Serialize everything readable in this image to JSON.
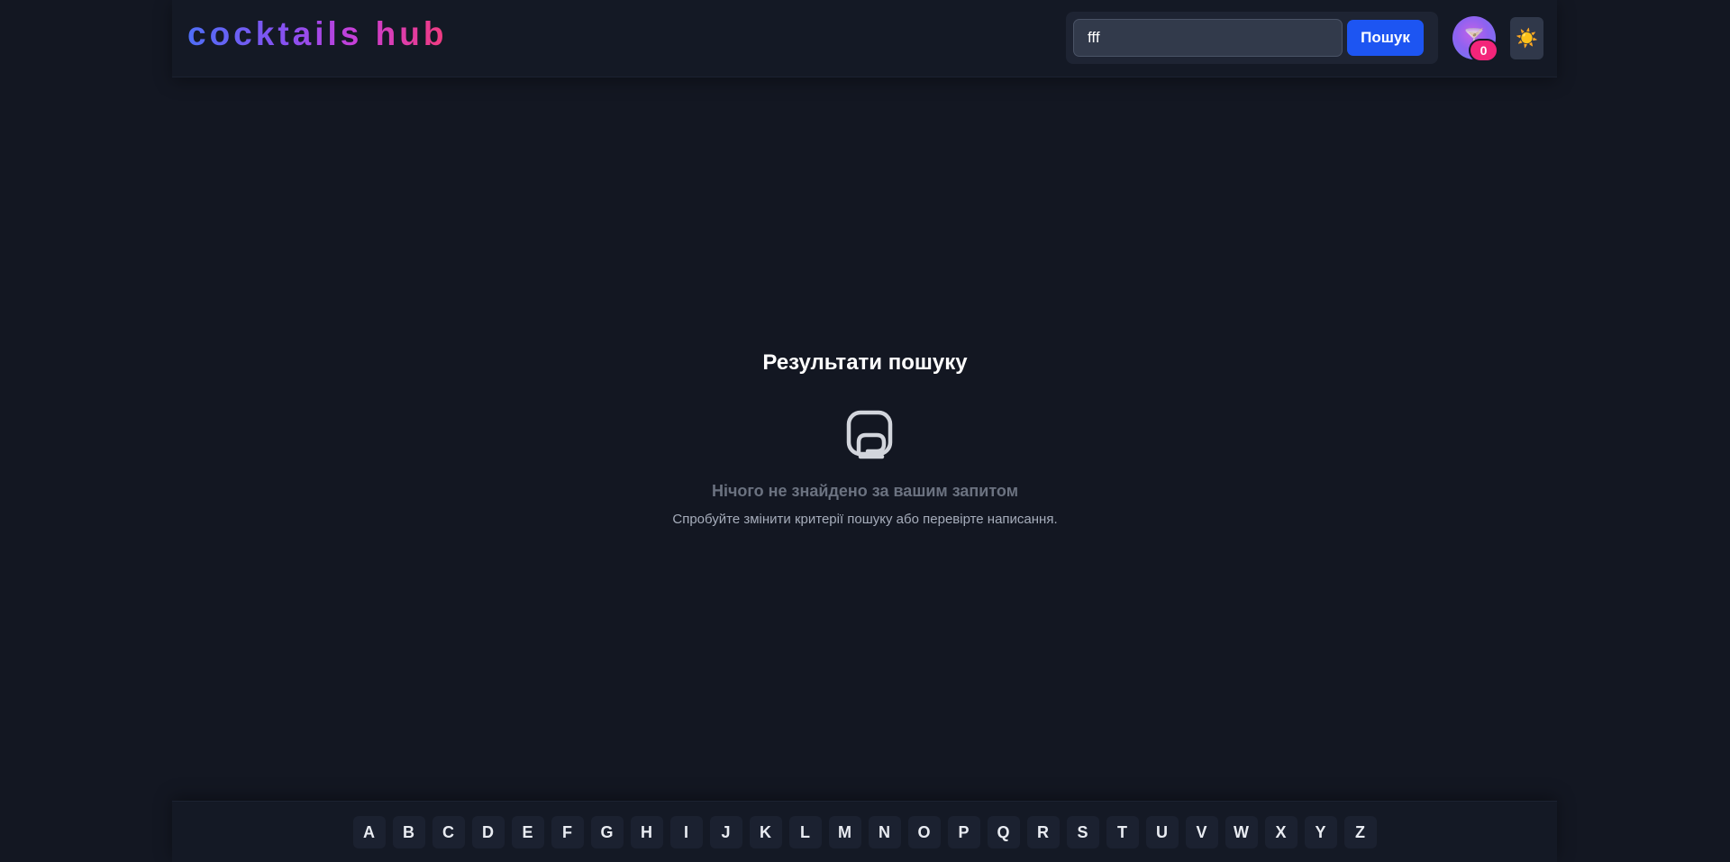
{
  "header": {
    "logo": "cocktails hub",
    "search": {
      "value": "fff",
      "placeholder": ""
    },
    "search_button": "Пошук",
    "favorites_count": "0",
    "avatar_icon": "cocktail-glass-icon",
    "theme_icon": "sun-icon",
    "theme_glyph": "☀️"
  },
  "main": {
    "title": "Результати пошуку",
    "empty_icon": "empty-results-icon",
    "empty_title": "Нічого не знайдено за вашим запитом",
    "empty_subtitle": "Спробуйте змінити критерії пошуку або перевірте написання."
  },
  "alphabet": [
    "A",
    "B",
    "C",
    "D",
    "E",
    "F",
    "G",
    "H",
    "I",
    "J",
    "K",
    "L",
    "M",
    "N",
    "O",
    "P",
    "Q",
    "R",
    "S",
    "T",
    "U",
    "V",
    "W",
    "X",
    "Y",
    "Z"
  ],
  "colors": {
    "background": "#131722",
    "accent": "#1d55f2",
    "badge": "#f3257a"
  }
}
